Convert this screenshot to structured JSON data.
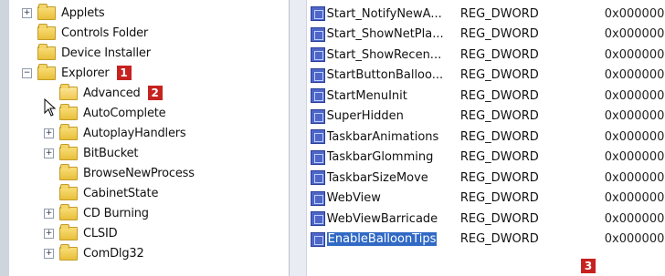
{
  "tree": {
    "items": [
      {
        "label": "Applets",
        "expander": "+",
        "indent": 0
      },
      {
        "label": "Controls Folder",
        "expander": "",
        "indent": 0
      },
      {
        "label": "Device Installer",
        "expander": "",
        "indent": 0
      },
      {
        "label": "Explorer",
        "expander": "−",
        "indent": 0,
        "badge": "1"
      },
      {
        "label": "Advanced",
        "expander": "",
        "indent": 1,
        "badge": "2",
        "open": true
      },
      {
        "label": "AutoComplete",
        "expander": "",
        "indent": 1
      },
      {
        "label": "AutoplayHandlers",
        "expander": "+",
        "indent": 1
      },
      {
        "label": "BitBucket",
        "expander": "+",
        "indent": 1
      },
      {
        "label": "BrowseNewProcess",
        "expander": "",
        "indent": 1
      },
      {
        "label": "CabinetState",
        "expander": "",
        "indent": 1
      },
      {
        "label": "CD Burning",
        "expander": "+",
        "indent": 1
      },
      {
        "label": "CLSID",
        "expander": "+",
        "indent": 1
      },
      {
        "label": "ComDlg32",
        "expander": "+",
        "indent": 1
      }
    ]
  },
  "values": {
    "rows": [
      {
        "name": "Start_NotifyNewA...",
        "type": "REG_DWORD",
        "data": "0x000000"
      },
      {
        "name": "Start_ShowNetPla...",
        "type": "REG_DWORD",
        "data": "0x000000"
      },
      {
        "name": "Start_ShowRecen...",
        "type": "REG_DWORD",
        "data": "0x000000"
      },
      {
        "name": "StartButtonBalloo...",
        "type": "REG_DWORD",
        "data": "0x000000"
      },
      {
        "name": "StartMenuInit",
        "type": "REG_DWORD",
        "data": "0x000000"
      },
      {
        "name": "SuperHidden",
        "type": "REG_DWORD",
        "data": "0x000000"
      },
      {
        "name": "TaskbarAnimations",
        "type": "REG_DWORD",
        "data": "0x000000"
      },
      {
        "name": "TaskbarGlomming",
        "type": "REG_DWORD",
        "data": "0x000000"
      },
      {
        "name": "TaskbarSizeMove",
        "type": "REG_DWORD",
        "data": "0x000000"
      },
      {
        "name": "WebView",
        "type": "REG_DWORD",
        "data": "0x000000"
      },
      {
        "name": "WebViewBarricade",
        "type": "REG_DWORD",
        "data": "0x000000"
      },
      {
        "name": "EnableBalloonTips",
        "type": "REG_DWORD",
        "data": "0x000000",
        "selected": true
      }
    ],
    "badge": "3"
  },
  "colors": {
    "badge": "#c6221f",
    "selection": "#316ac5"
  }
}
